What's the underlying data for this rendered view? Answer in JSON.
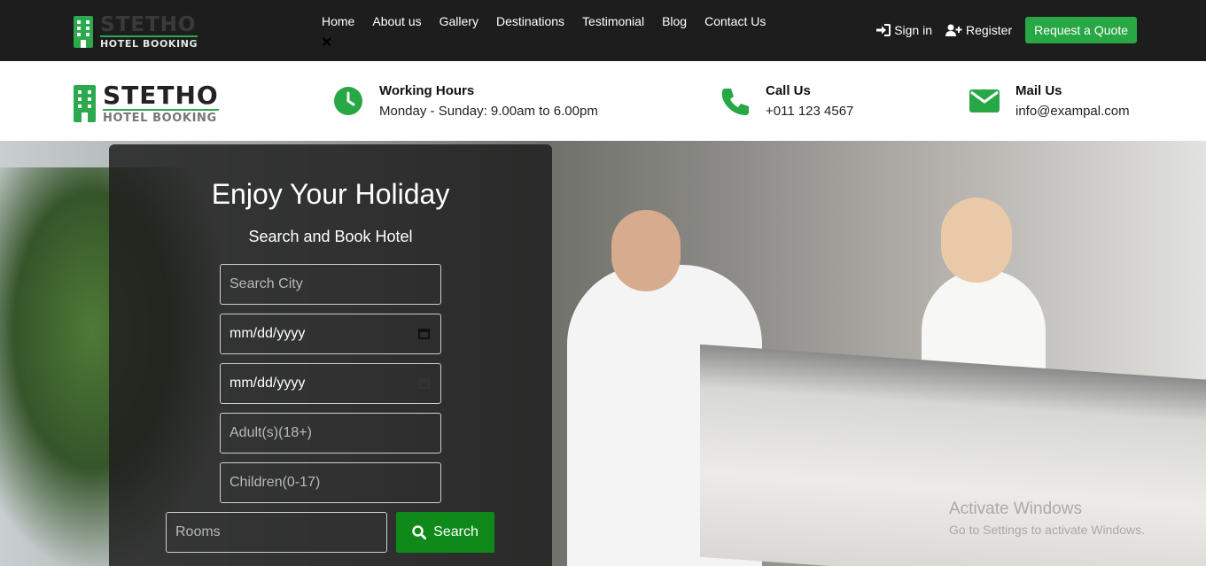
{
  "brand": {
    "name": "STETHO",
    "tagline": "HOTEL BOOKING"
  },
  "nav": {
    "items": [
      "Home",
      "About us",
      "Gallery",
      "Destinations",
      "Testimonial",
      "Blog",
      "Contact Us"
    ],
    "close_glyph": "✕"
  },
  "top_actions": {
    "sign_in": "Sign in",
    "register": "Register",
    "quote": "Request a Quote"
  },
  "info": {
    "hours": {
      "title": "Working Hours",
      "value": "Monday - Sunday: 9.00am to 6.00pm"
    },
    "call": {
      "title": "Call Us",
      "value": "+011 123 4567"
    },
    "mail": {
      "title": "Mail Us",
      "value": "info@exampal.com"
    }
  },
  "search": {
    "title": "Enjoy Your Holiday",
    "subtitle": "Search and Book Hotel",
    "city_placeholder": "Search City",
    "checkin_placeholder": "mm/dd/yyyy",
    "checkout_placeholder": "mm/dd/yyyy",
    "adults_placeholder": "Adult(s)(18+)",
    "children_placeholder": "Children(0-17)",
    "rooms_placeholder": "Rooms",
    "button": "Search"
  },
  "watermark": {
    "title": "Activate Windows",
    "subtitle": "Go to Settings to activate Windows."
  },
  "colors": {
    "topbar": "#1d1d1d",
    "accent": "#28a745",
    "search_button": "#0f8a1a"
  }
}
